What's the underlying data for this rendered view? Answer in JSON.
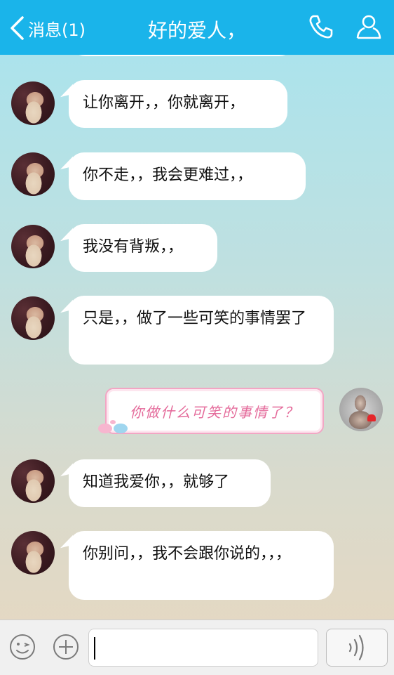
{
  "header": {
    "back_label": "消息(1)",
    "title": "好的爱人，"
  },
  "colors": {
    "header_bg": "#1ab4ea",
    "bubble_right_text": "#e46a9a",
    "bubble_right_border": "#f2a6c4"
  },
  "icons": {
    "back": "chevron-left-icon",
    "phone": "phone-icon",
    "contact": "person-icon",
    "emoji": "smiley-icon",
    "plus": "plus-icon",
    "voice": "sound-wave-icon"
  },
  "messages": [
    {
      "sender": "her",
      "text": "让你离开，，你就离开，"
    },
    {
      "sender": "her",
      "text": "你不走，，我会更难过，，"
    },
    {
      "sender": "her",
      "text": "我没有背叛，，"
    },
    {
      "sender": "her",
      "text": "只是，，做了一些可笑的事情罢了"
    },
    {
      "sender": "me",
      "text": "你做什么可笑的事情了？"
    },
    {
      "sender": "her",
      "text": "知道我爱你，，就够了"
    },
    {
      "sender": "her",
      "text": "你别问，，我不会跟你说的，，，"
    }
  ],
  "input": {
    "value": "",
    "placeholder": ""
  }
}
